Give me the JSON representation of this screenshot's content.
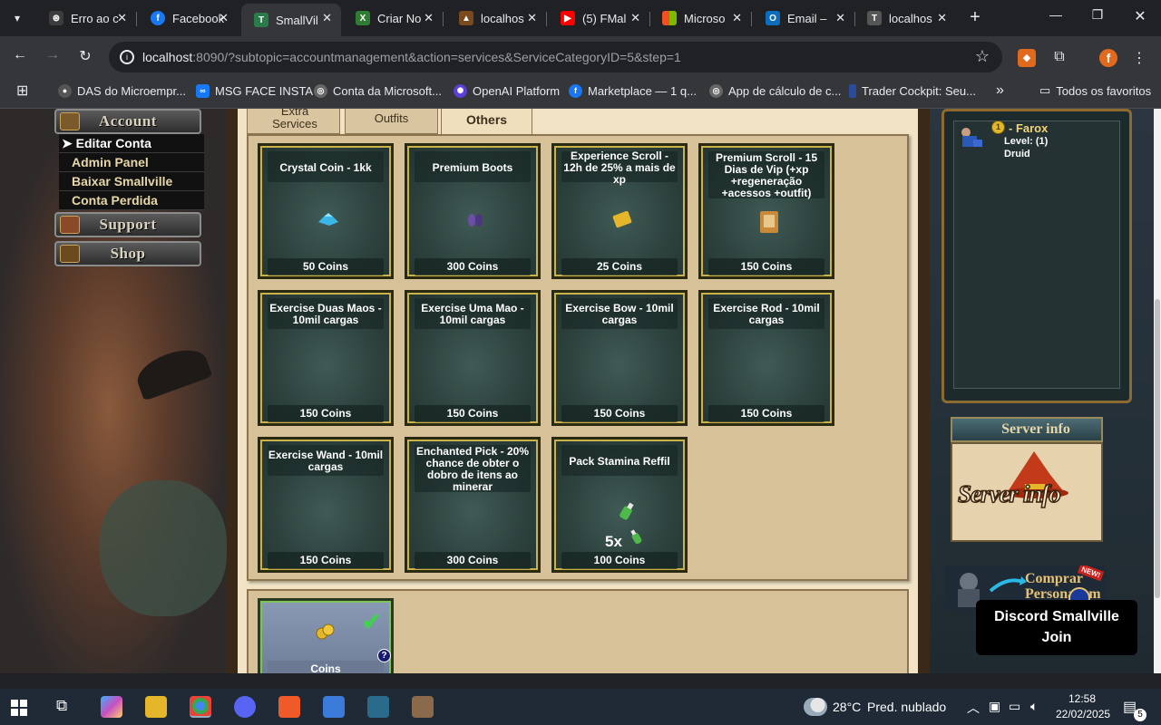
{
  "browser": {
    "tabs": [
      {
        "title": "Erro ao c",
        "icon": "chatgpt-icon",
        "color": "#3c3c3c"
      },
      {
        "title": "Facebook",
        "icon": "facebook-icon",
        "color": "#1877f2"
      },
      {
        "title": "SmallVil",
        "icon": "tibia-icon",
        "color": "#2a7a4a",
        "active": true
      },
      {
        "title": "Criar No",
        "icon": "x-icon",
        "color": "#2f7d32"
      },
      {
        "title": "localhos",
        "icon": "castle-icon",
        "color": "#7a4a1e"
      },
      {
        "title": "(5) FMal",
        "icon": "youtube-icon",
        "color": "#ff0000"
      },
      {
        "title": "Microso",
        "icon": "microsoft-icon",
        "color": "#f25022"
      },
      {
        "title": "Email –",
        "icon": "outlook-icon",
        "color": "#0f6cbd"
      },
      {
        "title": "localhos",
        "icon": "tibia-icon",
        "color": "#555555"
      }
    ],
    "url_host": "localhost",
    "url_rest": ":8090/?subtopic=accountmanagement&action=services&ServiceCategoryID=5&step=1",
    "profile_initial": "f",
    "bookmarks": [
      {
        "label": "DAS do Microempr...",
        "icon": "das-icon",
        "color": "#555"
      },
      {
        "label": "MSG FACE INSTA",
        "icon": "meta-icon",
        "color": "#1877f2"
      },
      {
        "label": "Conta da Microsoft...",
        "icon": "globe-icon",
        "color": "#666"
      },
      {
        "label": "OpenAI Platform",
        "icon": "openai-icon",
        "color": "#5b3fd6"
      },
      {
        "label": "Marketplace — 1 q...",
        "icon": "facebook-icon",
        "color": "#1877f2"
      },
      {
        "label": "App de cálculo de c...",
        "icon": "globe-icon",
        "color": "#666"
      },
      {
        "label": "Trader Cockpit: Seu...",
        "icon": "trader-icon",
        "color": "#2a4a9a"
      }
    ],
    "bookmarks_more": "»",
    "all_bookmarks": "Todos os favoritos"
  },
  "menu": {
    "account_header": "Account",
    "account_items": [
      "Editar Conta",
      "Admin Panel",
      "Baixar Smallville",
      "Conta Perdida"
    ],
    "support_header": "Support",
    "shop_header": "Shop"
  },
  "shop": {
    "tabs": [
      "Extra Services",
      "Outfits",
      "Others"
    ],
    "active_tab": "Others",
    "items": [
      {
        "name": "Crystal Coin - 1kk",
        "price": "50 Coins",
        "icon": "crystal-coin-icon"
      },
      {
        "name": "Premium Boots",
        "price": "300 Coins",
        "icon": "boots-icon"
      },
      {
        "name": "Experience Scroll - 12h de 25% a mais de xp",
        "price": "25 Coins",
        "icon": "scroll-icon"
      },
      {
        "name": "Premium Scroll - 15 Dias de Vip (+xp +regeneração +acessos +outfit)",
        "price": "150 Coins",
        "icon": "premium-scroll-icon"
      },
      {
        "name": "Exercise Duas Maos - 10mil cargas",
        "price": "150 Coins",
        "icon": ""
      },
      {
        "name": "Exercise Uma Mao - 10mil cargas",
        "price": "150 Coins",
        "icon": ""
      },
      {
        "name": "Exercise Bow - 10mil cargas",
        "price": "150 Coins",
        "icon": ""
      },
      {
        "name": "Exercise Rod - 10mil cargas",
        "price": "150 Coins",
        "icon": ""
      },
      {
        "name": "Exercise Wand - 10mil cargas",
        "price": "150 Coins",
        "icon": ""
      },
      {
        "name": "Enchanted Pick - 20% chance de obter o dobro de itens ao minerar",
        "price": "300 Coins",
        "icon": ""
      },
      {
        "name": "Pack Stamina Reffil",
        "price": "100 Coins",
        "icon": "stamina-potion-icon",
        "qty": "5x"
      }
    ],
    "payment": {
      "label": "Coins",
      "help": "?"
    }
  },
  "character": {
    "name": "- Farox",
    "level": "Level: (1)",
    "vocation": "Druid"
  },
  "sidebar": {
    "server_info_header": "Server info",
    "server_info_image_text": "Server info",
    "buy_character": "Comprar Personagem",
    "new_badge": "NEW!",
    "discord_line1": "Discord Smallville",
    "discord_line2": "Join"
  },
  "taskbar": {
    "weather_temp": "28°C",
    "weather_desc": "Pred. nublado",
    "time": "12:58",
    "date": "22/02/2025",
    "notifications": "5"
  }
}
